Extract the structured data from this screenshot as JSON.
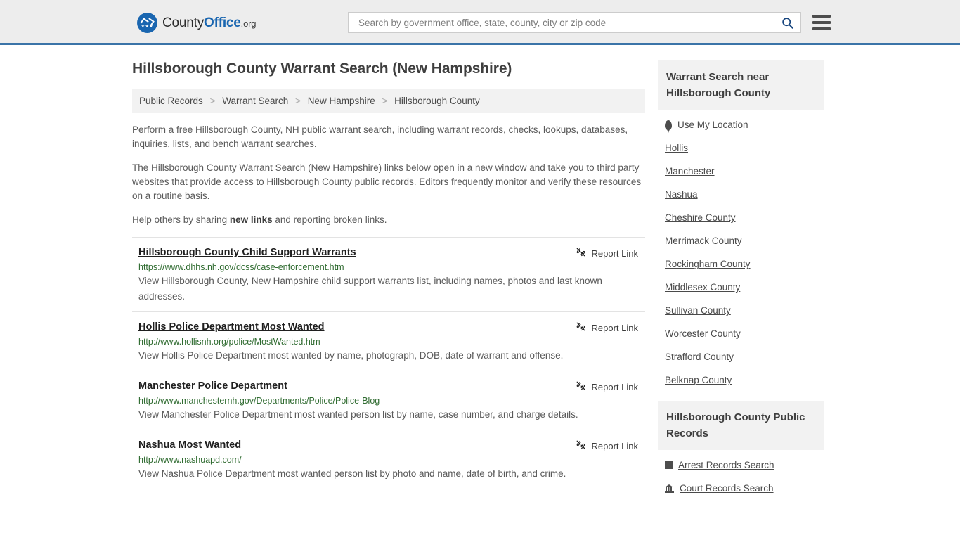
{
  "header": {
    "logo": {
      "part1": "County",
      "part2": "Office",
      "part3": ".org",
      "badge_stars": "★★★"
    },
    "search": {
      "placeholder": "Search by government office, state, county, city or zip code",
      "value": "",
      "search_icon": "search-icon"
    },
    "menu_icon": "hamburger-menu-icon",
    "accent_color": "#3b74a8"
  },
  "main": {
    "title": "Hillsborough County Warrant Search (New Hampshire)",
    "breadcrumb": [
      "Public Records",
      "Warrant Search",
      "New Hampshire",
      "Hillsborough County"
    ],
    "breadcrumb_separator": ">",
    "intro_1": "Perform a free Hillsborough County, NH public warrant search, including warrant records, checks, lookups, databases, inquiries, lists, and bench warrant searches.",
    "intro_2": "The Hillsborough County Warrant Search (New Hampshire) links below open in a new window and take you to third party websites that provide access to Hillsborough County public records. Editors frequently monitor and verify these resources on a routine basis.",
    "intro_3_pre": "Help others by sharing ",
    "intro_3_link": "new links",
    "intro_3_post": " and reporting broken links.",
    "report_link_label": "Report Link",
    "report_link_icon": "broken-link-icon",
    "results": [
      {
        "title": "Hillsborough County Child Support Warrants",
        "url": "https://www.dhhs.nh.gov/dcss/case-enforcement.htm",
        "description": "View Hillsborough County, New Hampshire child support warrants list, including names, photos and last known addresses."
      },
      {
        "title": "Hollis Police Department Most Wanted",
        "url": "http://www.hollisnh.org/police/MostWanted.htm",
        "description": "View Hollis Police Department most wanted by name, photograph, DOB, date of warrant and offense."
      },
      {
        "title": "Manchester Police Department",
        "url": "http://www.manchesternh.gov/Departments/Police/Police-Blog",
        "description": "View Manchester Police Department most wanted person list by name, case number, and charge details."
      },
      {
        "title": "Nashua Most Wanted",
        "url": "http://www.nashuapd.com/",
        "description": "View Nashua Police Department most wanted person list by photo and name, date of birth, and crime."
      }
    ]
  },
  "sidebar": {
    "nearby_title": "Warrant Search near Hillsborough County",
    "use_my_location": "Use My Location",
    "use_my_location_icon": "map-pin-icon",
    "nearby_items": [
      "Hollis",
      "Manchester",
      "Nashua",
      "Cheshire County",
      "Merrimack County",
      "Rockingham County",
      "Middlesex County",
      "Sullivan County",
      "Worcester County",
      "Strafford County",
      "Belknap County"
    ],
    "public_records_title": "Hillsborough County Public Records",
    "public_records_items": [
      {
        "label": "Arrest Records Search",
        "icon": "square-icon"
      },
      {
        "label": "Court Records Search",
        "icon": "courthouse-icon"
      }
    ]
  },
  "colors": {
    "header_bg": "#ededed",
    "accent_blue": "#3b74a8",
    "url_green": "#2f6b30",
    "panel_gray": "#f2f2f2"
  }
}
